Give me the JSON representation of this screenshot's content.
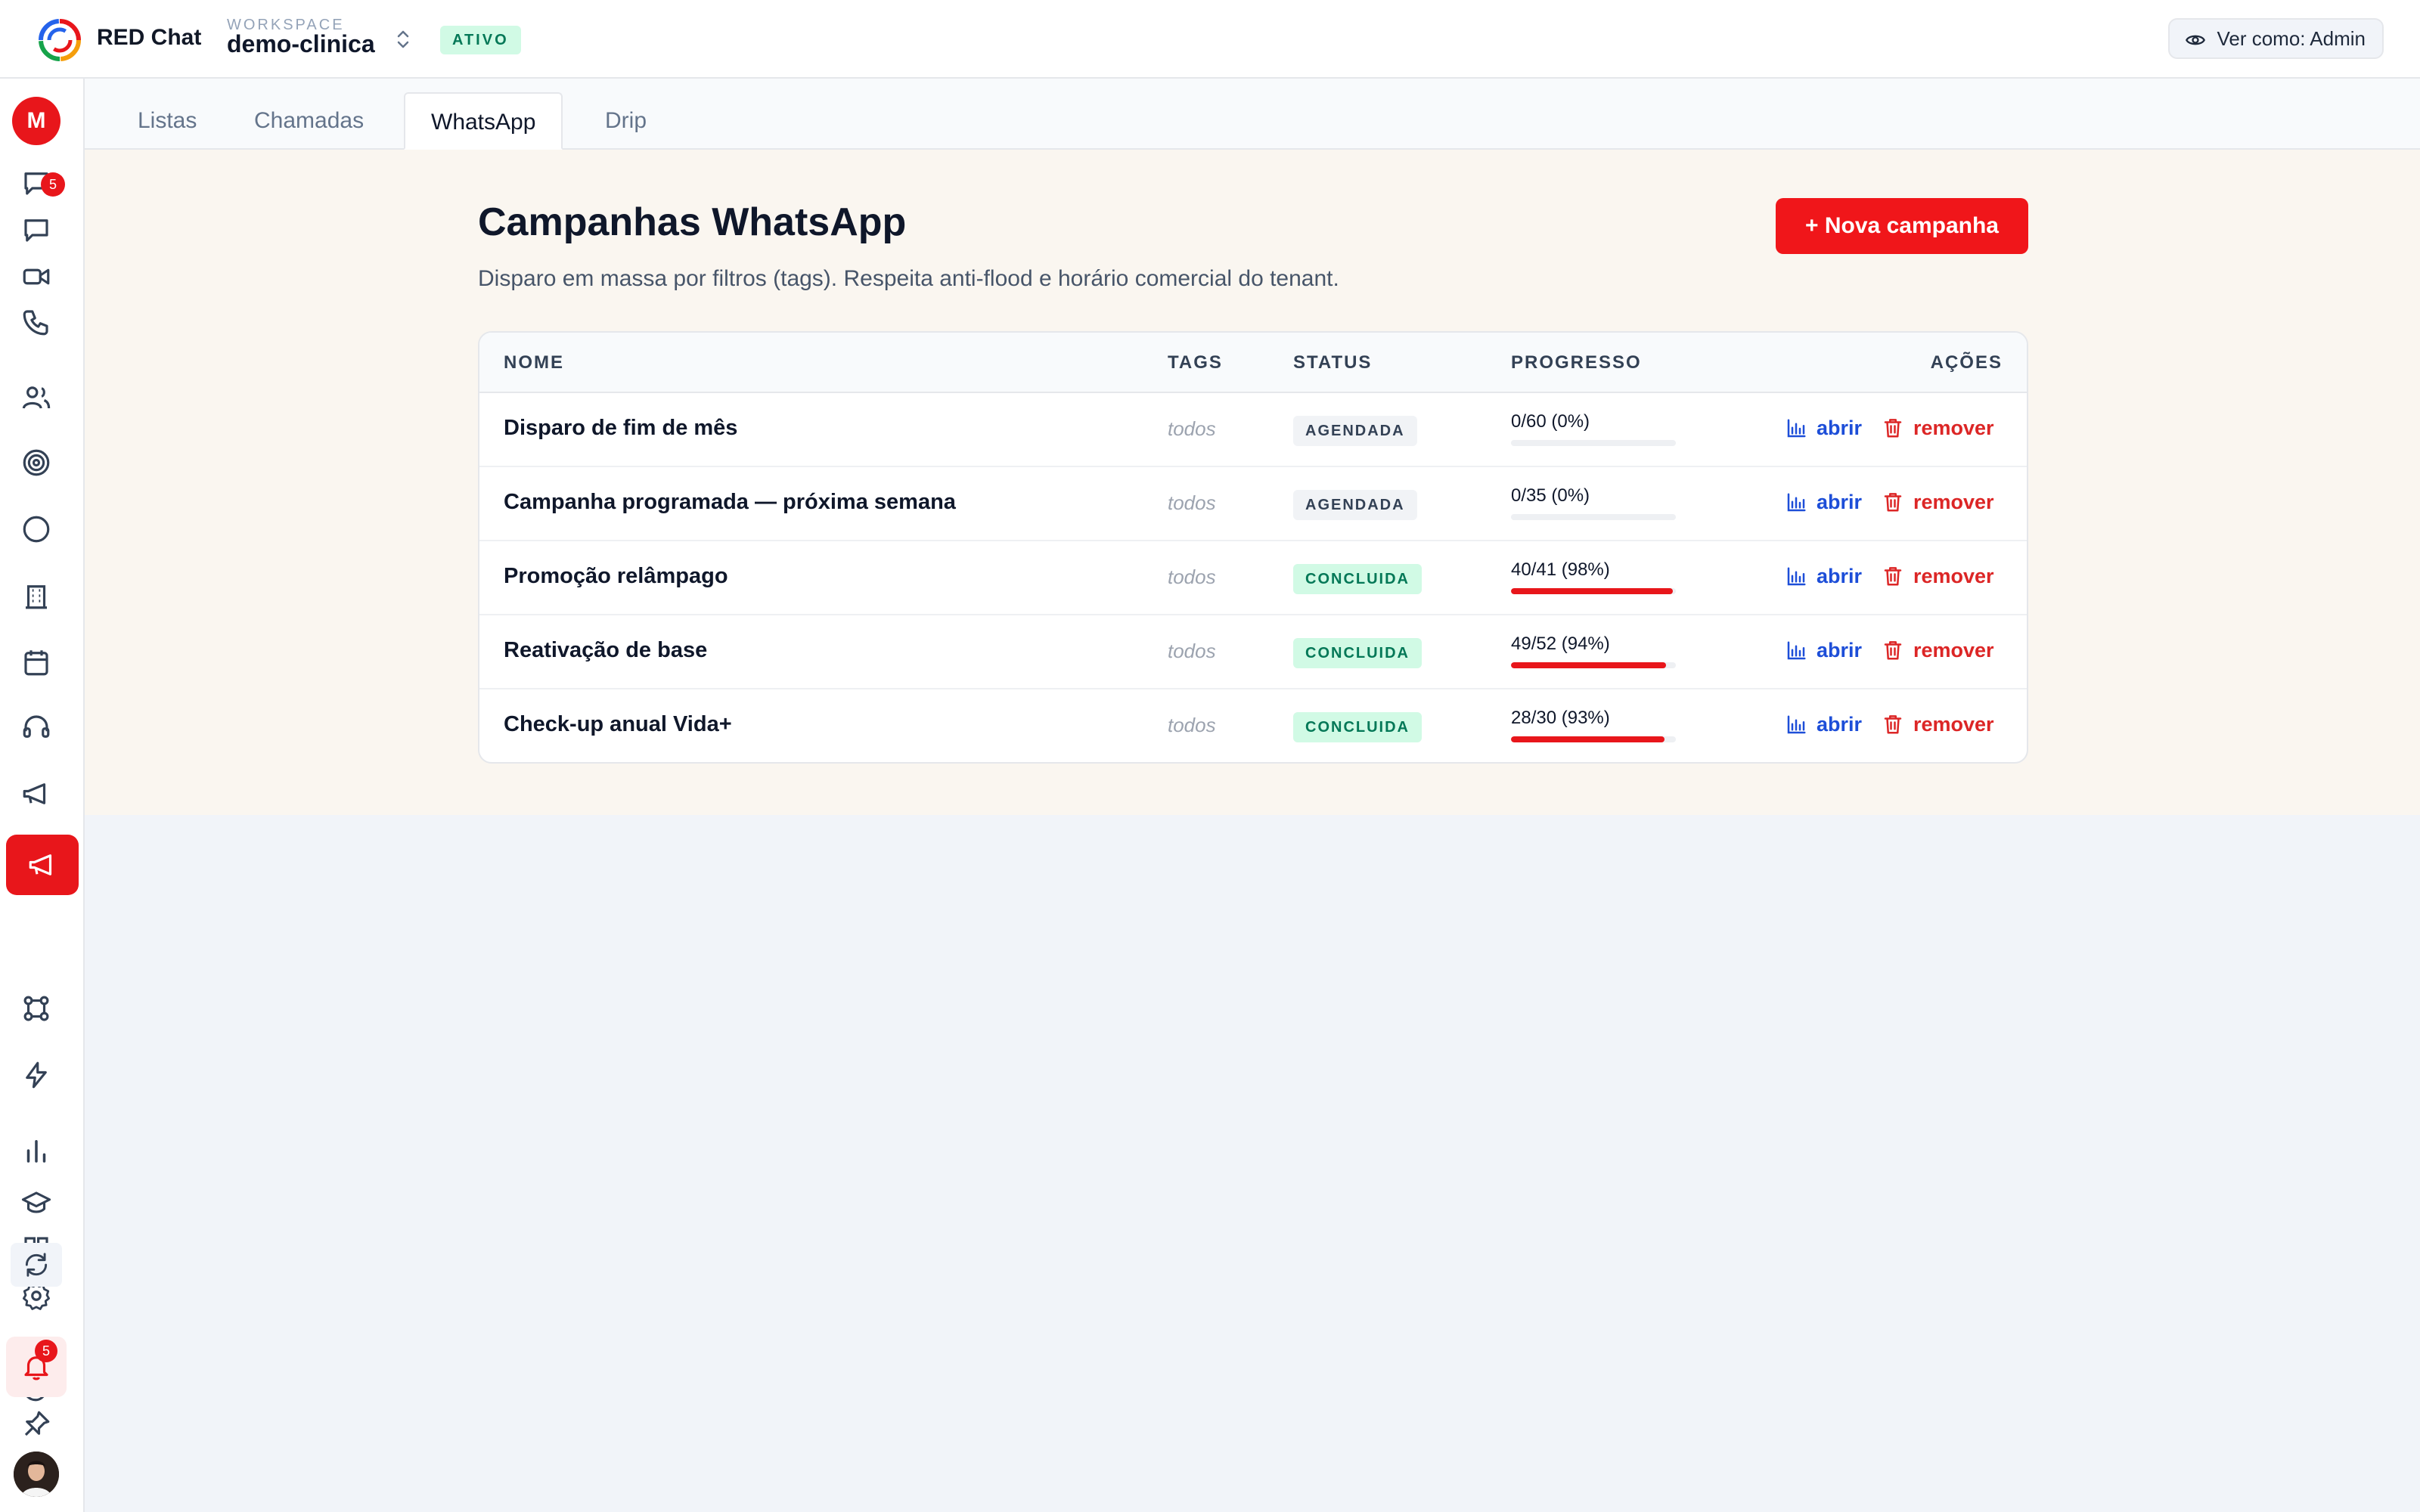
{
  "header": {
    "brand": "RED Chat",
    "workspace_label": "WORKSPACE",
    "workspace_name": "demo-clinica",
    "workspace_status": "ATIVO",
    "view_as": "Ver como: Admin"
  },
  "sidebar": {
    "user_initial": "M",
    "conversations_badge": "5",
    "notifications_badge": "5",
    "items": [
      "conversations-icon",
      "chat-icon",
      "video-icon",
      "phone-icon",
      "contacts-icon",
      "target-icon",
      "circle-icon",
      "building-icon",
      "calendar-icon",
      "headset-icon",
      "megaphone-icon",
      "campaigns-icon",
      "integrations-icon",
      "automations-icon",
      "reports-icon",
      "academy-icon",
      "apps-icon",
      "settings-icon",
      "refresh-icon",
      "dark-mode-icon",
      "notifications-icon",
      "pin-icon",
      "user-avatar"
    ]
  },
  "tabs": [
    {
      "label": "Listas",
      "active": false
    },
    {
      "label": "Chamadas",
      "active": false
    },
    {
      "label": "WhatsApp",
      "active": true
    },
    {
      "label": "Drip",
      "active": false
    }
  ],
  "page": {
    "title": "Campanhas WhatsApp",
    "subtitle": "Disparo em massa por filtros (tags). Respeita anti-flood e horário comercial do tenant.",
    "new_button": "+ Nova campanha"
  },
  "table": {
    "headers": {
      "name": "NOME",
      "tags": "TAGS",
      "status": "STATUS",
      "progress": "PROGRESSO",
      "actions": "AÇÕES"
    },
    "action_open": "abrir",
    "action_remove": "remover",
    "rows": [
      {
        "name": "Disparo de fim de mês",
        "tags": "todos",
        "status": "AGENDADA",
        "status_kind": "agendada",
        "progress_text": "0/60 (0%)",
        "progress": 0
      },
      {
        "name": "Campanha programada — próxima semana",
        "tags": "todos",
        "status": "AGENDADA",
        "status_kind": "agendada",
        "progress_text": "0/35 (0%)",
        "progress": 0
      },
      {
        "name": "Promoção relâmpago",
        "tags": "todos",
        "status": "CONCLUIDA",
        "status_kind": "concluida",
        "progress_text": "40/41 (98%)",
        "progress": 98
      },
      {
        "name": "Reativação de base",
        "tags": "todos",
        "status": "CONCLUIDA",
        "status_kind": "concluida",
        "progress_text": "49/52 (94%)",
        "progress": 94
      },
      {
        "name": "Check-up anual Vida+",
        "tags": "todos",
        "status": "CONCLUIDA",
        "status_kind": "concluida",
        "progress_text": "28/30 (93%)",
        "progress": 93
      }
    ]
  },
  "colors": {
    "accent": "#e8161b",
    "link": "#1d4ed8",
    "danger": "#dc2626",
    "success_bg": "#d1fae5",
    "success_fg": "#047857"
  }
}
